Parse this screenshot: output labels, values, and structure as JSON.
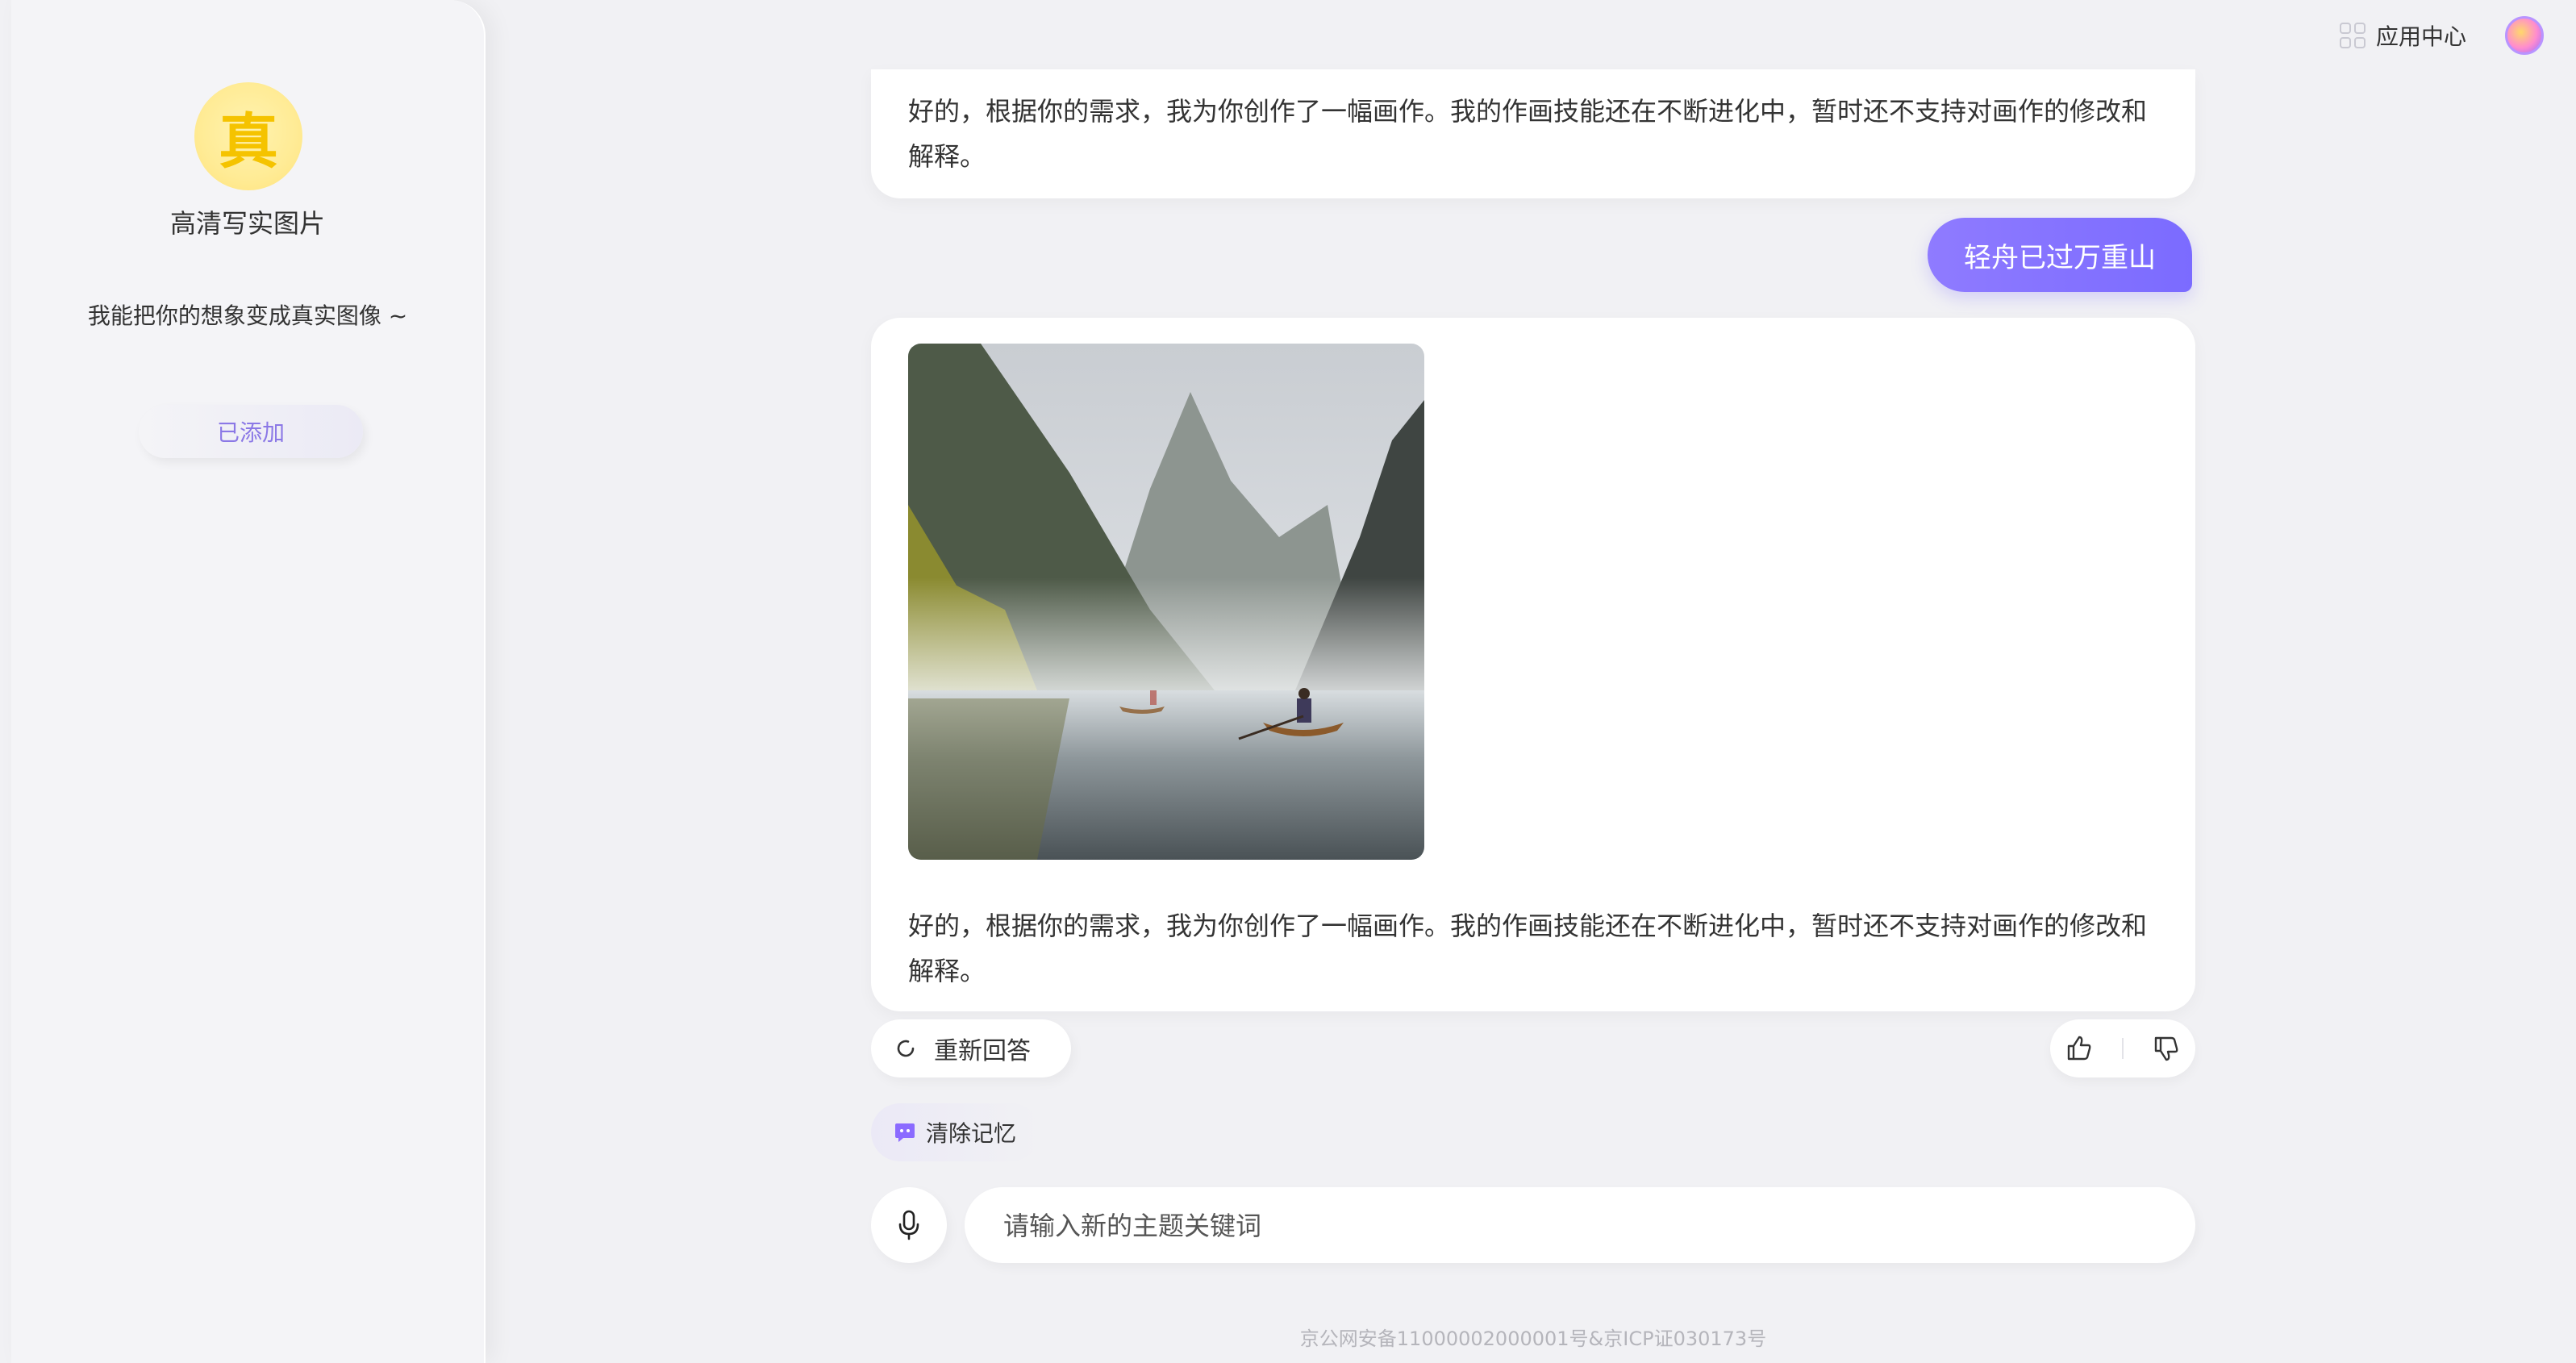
{
  "header": {
    "app_center_label": "应用中心"
  },
  "sidebar": {
    "avatar_char": "真",
    "bot_name": "高清写实图片",
    "bot_description": "我能把你的想象变成真实图像 ~",
    "added_label": "已添加"
  },
  "chat": {
    "messages": [
      {
        "role": "assistant",
        "text": "好的，根据你的需求，我为你创作了一幅画作。我的作画技能还在不断进化中，暂时还不支持对画作的修改和解释。"
      },
      {
        "role": "user",
        "text": "轻舟已过万重山"
      },
      {
        "role": "assistant",
        "text": "好的，根据你的需求，我为你创作了一幅画作。我的作画技能还在不断进化中，暂时还不支持对画作的修改和解释。"
      }
    ],
    "regenerate_label": "重新回答",
    "clear_memory_label": "清除记忆"
  },
  "input": {
    "placeholder": "请输入新的主题关键词",
    "value": ""
  },
  "footer": {
    "text": "京公网安备11000002000001号&京ICP证030173号"
  },
  "colors": {
    "accent": "#7b6bff",
    "avatar_bg": "#ffeb95"
  }
}
